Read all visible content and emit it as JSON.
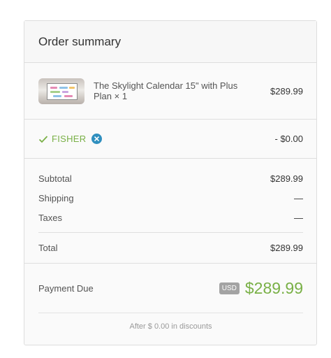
{
  "order_summary": {
    "title": "Order summary",
    "line_item": {
      "name": "The Skylight Calendar 15\" with Plus Plan",
      "quantity": "× 1",
      "price": "$289.99",
      "thumbnail_icon": "product-thumbnail"
    },
    "discount": {
      "code": "FISHER",
      "amount": "- $0.00",
      "applied_icon": "check-icon",
      "remove_icon": "close-icon"
    },
    "totals": {
      "subtotal_label": "Subtotal",
      "subtotal_value": "$289.99",
      "shipping_label": "Shipping",
      "shipping_value": "—",
      "taxes_label": "Taxes",
      "taxes_value": "—",
      "total_label": "Total",
      "total_value": "$289.99"
    },
    "payment": {
      "label": "Payment Due",
      "currency": "USD",
      "amount": "$289.99"
    },
    "savings_note": "After $ 0.00 in discounts"
  },
  "colors": {
    "accent_green": "#79b046",
    "remove_blue": "#2f8fbf",
    "badge_gray": "#a3a3a3"
  }
}
